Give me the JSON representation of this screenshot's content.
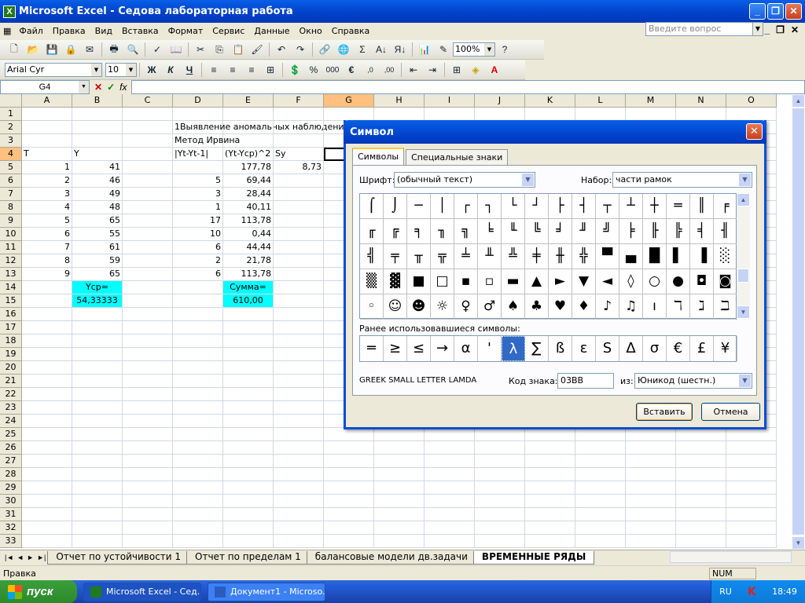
{
  "window": {
    "title": "Microsoft Excel - Седова лабораторная работа"
  },
  "menu": [
    "Файл",
    "Правка",
    "Вид",
    "Вставка",
    "Формат",
    "Сервис",
    "Данные",
    "Окно",
    "Справка"
  ],
  "ask": {
    "placeholder": "Введите вопрос"
  },
  "toolbar": {
    "zoom": "100%",
    "font": "Arial Cyr",
    "size": "10",
    "bold": "Ж",
    "italic": "К",
    "underline": "Ч",
    "percent": "%",
    "thousands": "000",
    "euro": "€"
  },
  "formula": {
    "namebox": "G4",
    "fx": "fx"
  },
  "columns": [
    "A",
    "B",
    "C",
    "D",
    "E",
    "F",
    "G",
    "H",
    "I",
    "J",
    "K",
    "L",
    "M",
    "N",
    "O"
  ],
  "rows": [
    "1",
    "2",
    "3",
    "4",
    "5",
    "6",
    "7",
    "8",
    "9",
    "10",
    "11",
    "12",
    "13",
    "14",
    "15",
    "16",
    "17",
    "18",
    "19",
    "20",
    "21",
    "22",
    "23",
    "24",
    "25",
    "26",
    "27",
    "28",
    "29",
    "30",
    "31",
    "32",
    "33"
  ],
  "cells": {
    "D2": "1Выявление аномальных наблюдений",
    "D3": "Метод Ирвина",
    "A4": "T",
    "B4": "Y",
    "D4": "|Yt-Yt-1|",
    "E4": "(Yt-Ycp)^2",
    "F4": "Sy",
    "A5": "1",
    "B5": "41",
    "E5": "177,78",
    "F5": "8,73",
    "A6": "2",
    "B6": "46",
    "D6": "5",
    "E6": "69,44",
    "A7": "3",
    "B7": "49",
    "D7": "3",
    "E7": "28,44",
    "A8": "4",
    "B8": "48",
    "D8": "1",
    "E8": "40,11",
    "A9": "5",
    "B9": "65",
    "D9": "17",
    "E9": "113,78",
    "A10": "6",
    "B10": "55",
    "D10": "10",
    "E10": "0,44",
    "A11": "7",
    "B11": "61",
    "D11": "6",
    "E11": "44,44",
    "A12": "8",
    "B12": "59",
    "D12": "2",
    "E12": "21,78",
    "A13": "9",
    "B13": "65",
    "D13": "6",
    "E13": "113,78",
    "B14": "Ycp=",
    "B15": "54,33333",
    "E14": "Сумма=",
    "E15": "610,00"
  },
  "sheets": [
    "Отчет по устойчивости 1",
    "Отчет по пределам 1",
    "балансовые модели дв.задачи",
    "ВРЕМЕННЫЕ РЯДЫ"
  ],
  "status": {
    "text": "Правка",
    "num": "NUM"
  },
  "taskbar": {
    "start": "пуск",
    "tasks": [
      "Microsoft Excel - Сед...",
      "Документ1 - Microso..."
    ],
    "lang": "RU",
    "time": "18:49"
  },
  "dialog": {
    "title": "Символ",
    "tabs": [
      "Символы",
      "Специальные знаки"
    ],
    "font_label": "Шрифт:",
    "font_value": "(обычный текст)",
    "set_label": "Набор:",
    "set_value": "части рамок",
    "symbols": [
      "⌠",
      "⌡",
      "─",
      "│",
      "┌",
      "┐",
      "└",
      "┘",
      "├",
      "┤",
      "┬",
      "┴",
      "┼",
      "═",
      "║",
      "╒",
      "╓",
      "╔",
      "╕",
      "╖",
      "╗",
      "╘",
      "╙",
      "╚",
      "╛",
      "╜",
      "╝",
      "╞",
      "╟",
      "╠",
      "╡",
      "╢",
      "╣",
      "╤",
      "╥",
      "╦",
      "╧",
      "╨",
      "╩",
      "╪",
      "╫",
      "╬",
      "▀",
      "▄",
      "█",
      "▌",
      "▐",
      "░",
      "▒",
      "▓",
      "■",
      "□",
      "▪",
      "▫",
      "▬",
      "▲",
      "►",
      "▼",
      "◄",
      "◊",
      "○",
      "●",
      "◘",
      "◙",
      "◦",
      "☺",
      "☻",
      "☼",
      "♀",
      "♂",
      "♠",
      "♣",
      "♥",
      "♦",
      "♪",
      "♫",
      "ı",
      "ℸ",
      "ℷ",
      "ℶ"
    ],
    "recent_label": "Ранее использовавшиеся символы:",
    "recent": [
      "═",
      "≥",
      "≤",
      "→",
      "α",
      "'",
      "λ",
      "∑",
      "ß",
      "ε",
      "S",
      "∆",
      "σ",
      "€",
      "£",
      "¥"
    ],
    "char_name": "GREEK SMALL LETTER LAMDA",
    "code_label": "Код знака:",
    "code_value": "03BB",
    "from_label": "из:",
    "from_value": "Юникод (шестн.)",
    "insert": "Вставить",
    "cancel": "Отмена"
  }
}
